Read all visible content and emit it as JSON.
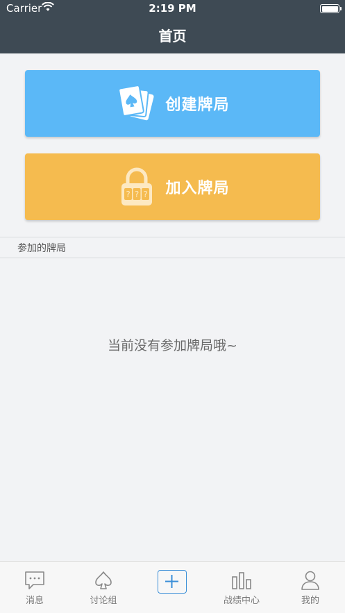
{
  "status_bar": {
    "carrier": "Carrier",
    "time": "2:19 PM"
  },
  "nav": {
    "title": "首页"
  },
  "actions": {
    "create": {
      "label": "创建牌局",
      "icon": "playing-cards-icon",
      "color": "#5bb8f7"
    },
    "join": {
      "label": "加入牌局",
      "icon": "combination-lock-icon",
      "color": "#f5bb4f"
    }
  },
  "section": {
    "title": "参加的牌局"
  },
  "empty_state": {
    "message": "当前没有参加牌局哦~"
  },
  "tabbar": {
    "items": [
      {
        "label": "消息",
        "icon": "chat-bubble-icon"
      },
      {
        "label": "讨论组",
        "icon": "spade-icon"
      },
      {
        "label": "",
        "icon": "plus-icon"
      },
      {
        "label": "战绩中心",
        "icon": "bar-chart-icon"
      },
      {
        "label": "我的",
        "icon": "user-icon"
      }
    ]
  },
  "colors": {
    "header_bg": "#3e4a54",
    "accent": "#3b8fd8"
  }
}
